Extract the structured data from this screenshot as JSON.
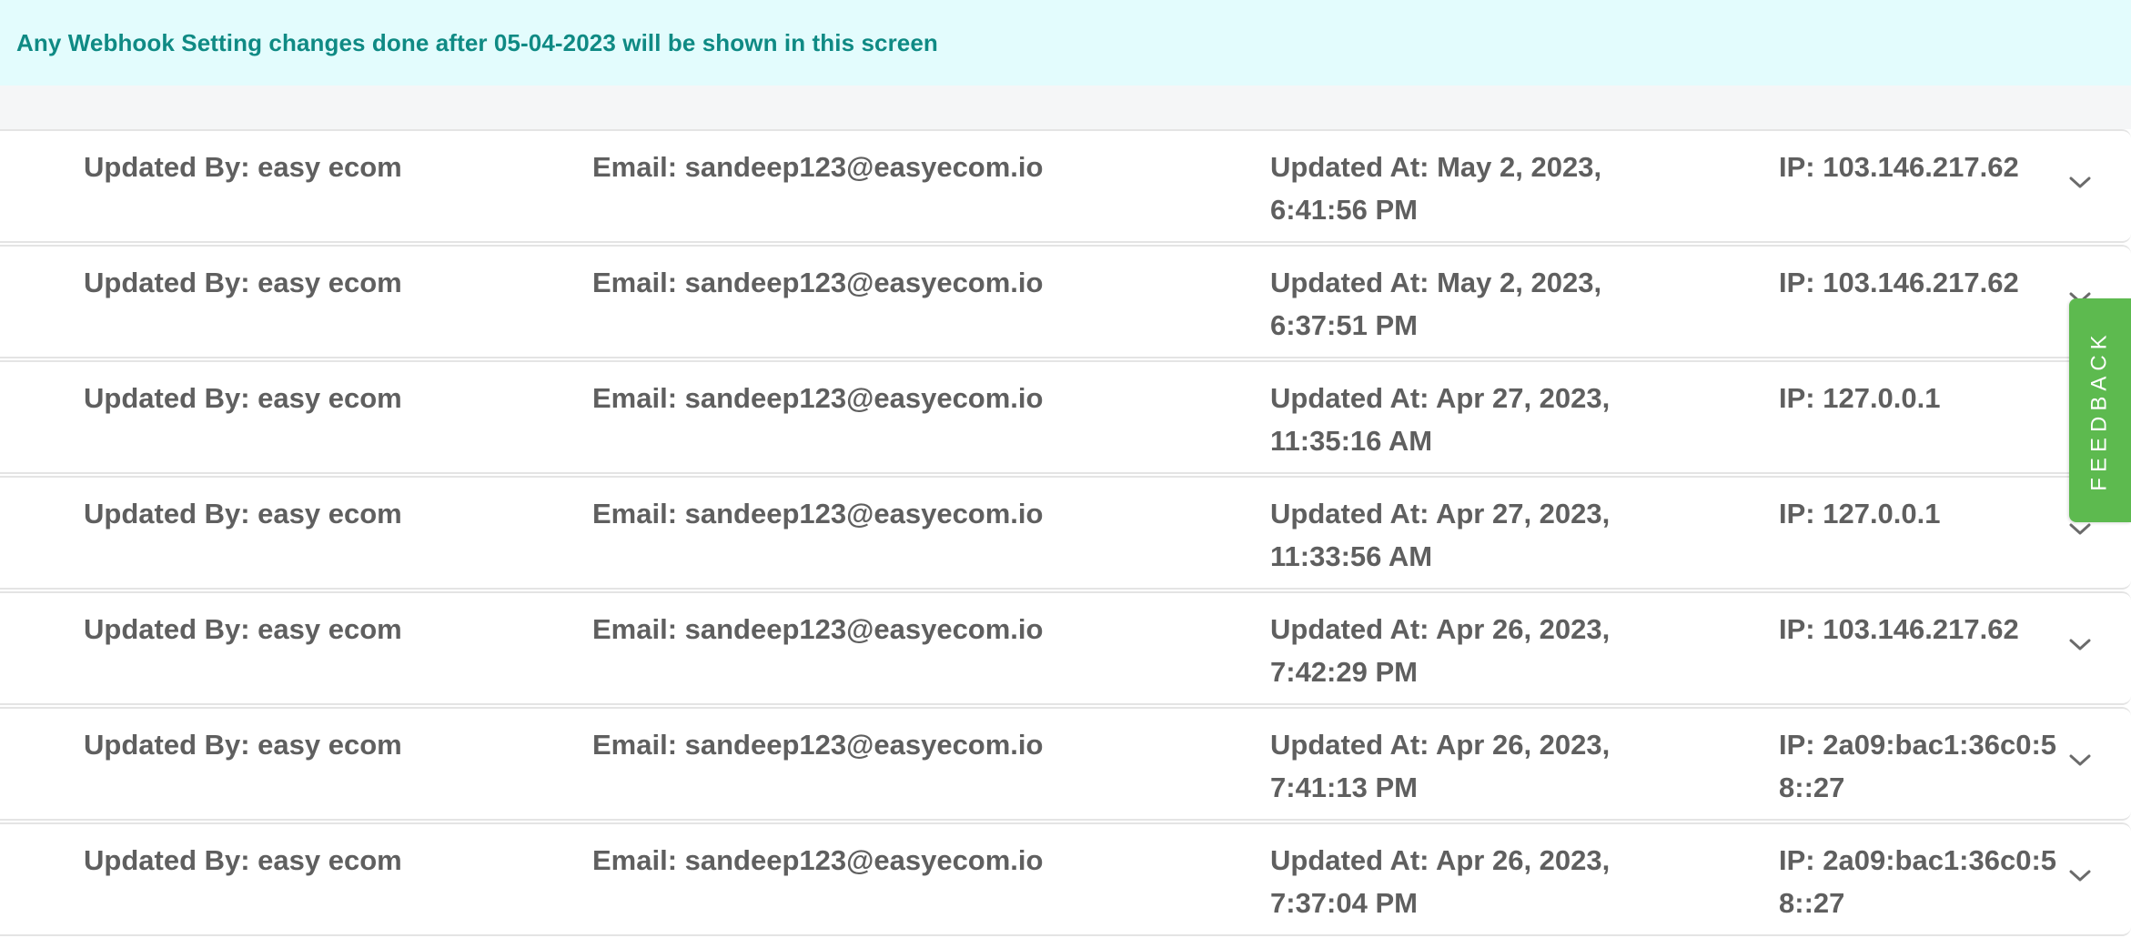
{
  "notice": {
    "text": "Any Webhook Setting changes done after 05-04-2023 will be shown in this screen"
  },
  "feedback_tab": {
    "label": "FEEDBACK",
    "color": "#5dba4f"
  },
  "colors": {
    "notice_bg": "#e3fcfd",
    "notice_text": "#0f8a84",
    "row_text": "#5f5f5f"
  },
  "rows": [
    {
      "updated_by": "Updated By: easy ecom",
      "email": "Email: sandeep123@easyecom.io",
      "updated_at": "Updated At: May 2, 2023, 6:41:56 PM",
      "ip": "IP: 103.146.217.62",
      "expand_icon": "chevron-down-icon"
    },
    {
      "updated_by": "Updated By: easy ecom",
      "email": "Email: sandeep123@easyecom.io",
      "updated_at": "Updated At: May 2, 2023, 6:37:51 PM",
      "ip": "IP: 103.146.217.62",
      "expand_icon": "chevron-down-icon"
    },
    {
      "updated_by": "Updated By: easy ecom",
      "email": "Email: sandeep123@easyecom.io",
      "updated_at": "Updated At: Apr 27, 2023, 11:35:16 AM",
      "ip": "IP: 127.0.0.1",
      "expand_icon": "chevron-down-icon"
    },
    {
      "updated_by": "Updated By: easy ecom",
      "email": "Email: sandeep123@easyecom.io",
      "updated_at": "Updated At: Apr 27, 2023, 11:33:56 AM",
      "ip": "IP: 127.0.0.1",
      "expand_icon": "chevron-down-icon"
    },
    {
      "updated_by": "Updated By: easy ecom",
      "email": "Email: sandeep123@easyecom.io",
      "updated_at": "Updated At: Apr 26, 2023, 7:42:29 PM",
      "ip": "IP: 103.146.217.62",
      "expand_icon": "chevron-down-icon"
    },
    {
      "updated_by": "Updated By: easy ecom",
      "email": "Email: sandeep123@easyecom.io",
      "updated_at": "Updated At: Apr 26, 2023, 7:41:13 PM",
      "ip": "IP: 2a09:bac1:36c0:58::27",
      "expand_icon": "chevron-down-icon"
    },
    {
      "updated_by": "Updated By: easy ecom",
      "email": "Email: sandeep123@easyecom.io",
      "updated_at": "Updated At: Apr 26, 2023, 7:37:04 PM",
      "ip": "IP: 2a09:bac1:36c0:58::27",
      "expand_icon": "chevron-down-icon"
    }
  ]
}
